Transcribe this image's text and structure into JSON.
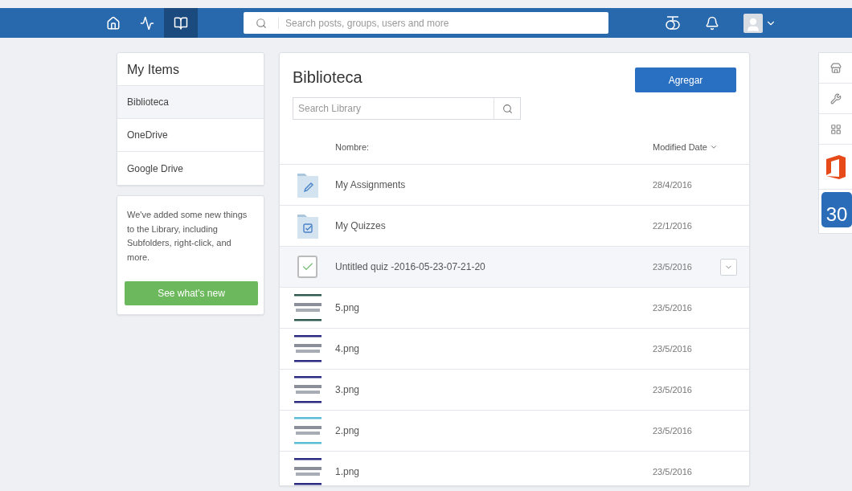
{
  "nav": {
    "tabs": [
      {
        "kind": "home",
        "selected": false
      },
      {
        "kind": "activity",
        "selected": false
      },
      {
        "kind": "library",
        "selected": true
      }
    ],
    "search": {
      "placeholder": "Search posts, groups, users and more"
    }
  },
  "sidebar": {
    "title": "My Items",
    "items": [
      {
        "label": "Biblioteca",
        "selected": true
      },
      {
        "label": "OneDrive",
        "selected": false
      },
      {
        "label": "Google Drive",
        "selected": false
      }
    ],
    "notice": {
      "text": "We've added some new things to the Library, including Subfolders, right-click, and more.",
      "button": "See what's new"
    }
  },
  "library": {
    "title": "Biblioteca",
    "add_button": "Agregar",
    "search": {
      "placeholder": "Search Library"
    },
    "columns": {
      "name": "Nombre:",
      "date": "Modified Date"
    },
    "rows": [
      {
        "kind": "assignments",
        "name": "My Assignments",
        "date": "28/4/2016",
        "selected": false
      },
      {
        "kind": "quizzes",
        "name": "My Quizzes",
        "date": "22/1/2016",
        "selected": false
      },
      {
        "kind": "quiz",
        "name": "Untitled quiz -2016-05-23-07-21-20",
        "date": "23/5/2016",
        "selected": true
      },
      {
        "kind": "image",
        "name": "5.png",
        "date": "23/5/2016",
        "selected": false,
        "color": "#2f5a52"
      },
      {
        "kind": "image",
        "name": "4.png",
        "date": "23/5/2016",
        "selected": false,
        "color": "#2a2a80"
      },
      {
        "kind": "image",
        "name": "3.png",
        "date": "23/5/2016",
        "selected": false,
        "color": "#2a2a80"
      },
      {
        "kind": "image",
        "name": "2.png",
        "date": "23/5/2016",
        "selected": false,
        "color": "#5bbcd6"
      },
      {
        "kind": "image",
        "name": "1.png",
        "date": "23/5/2016",
        "selected": false,
        "color": "#2a2a80"
      }
    ]
  },
  "rail": {
    "calendar_day": "30"
  }
}
